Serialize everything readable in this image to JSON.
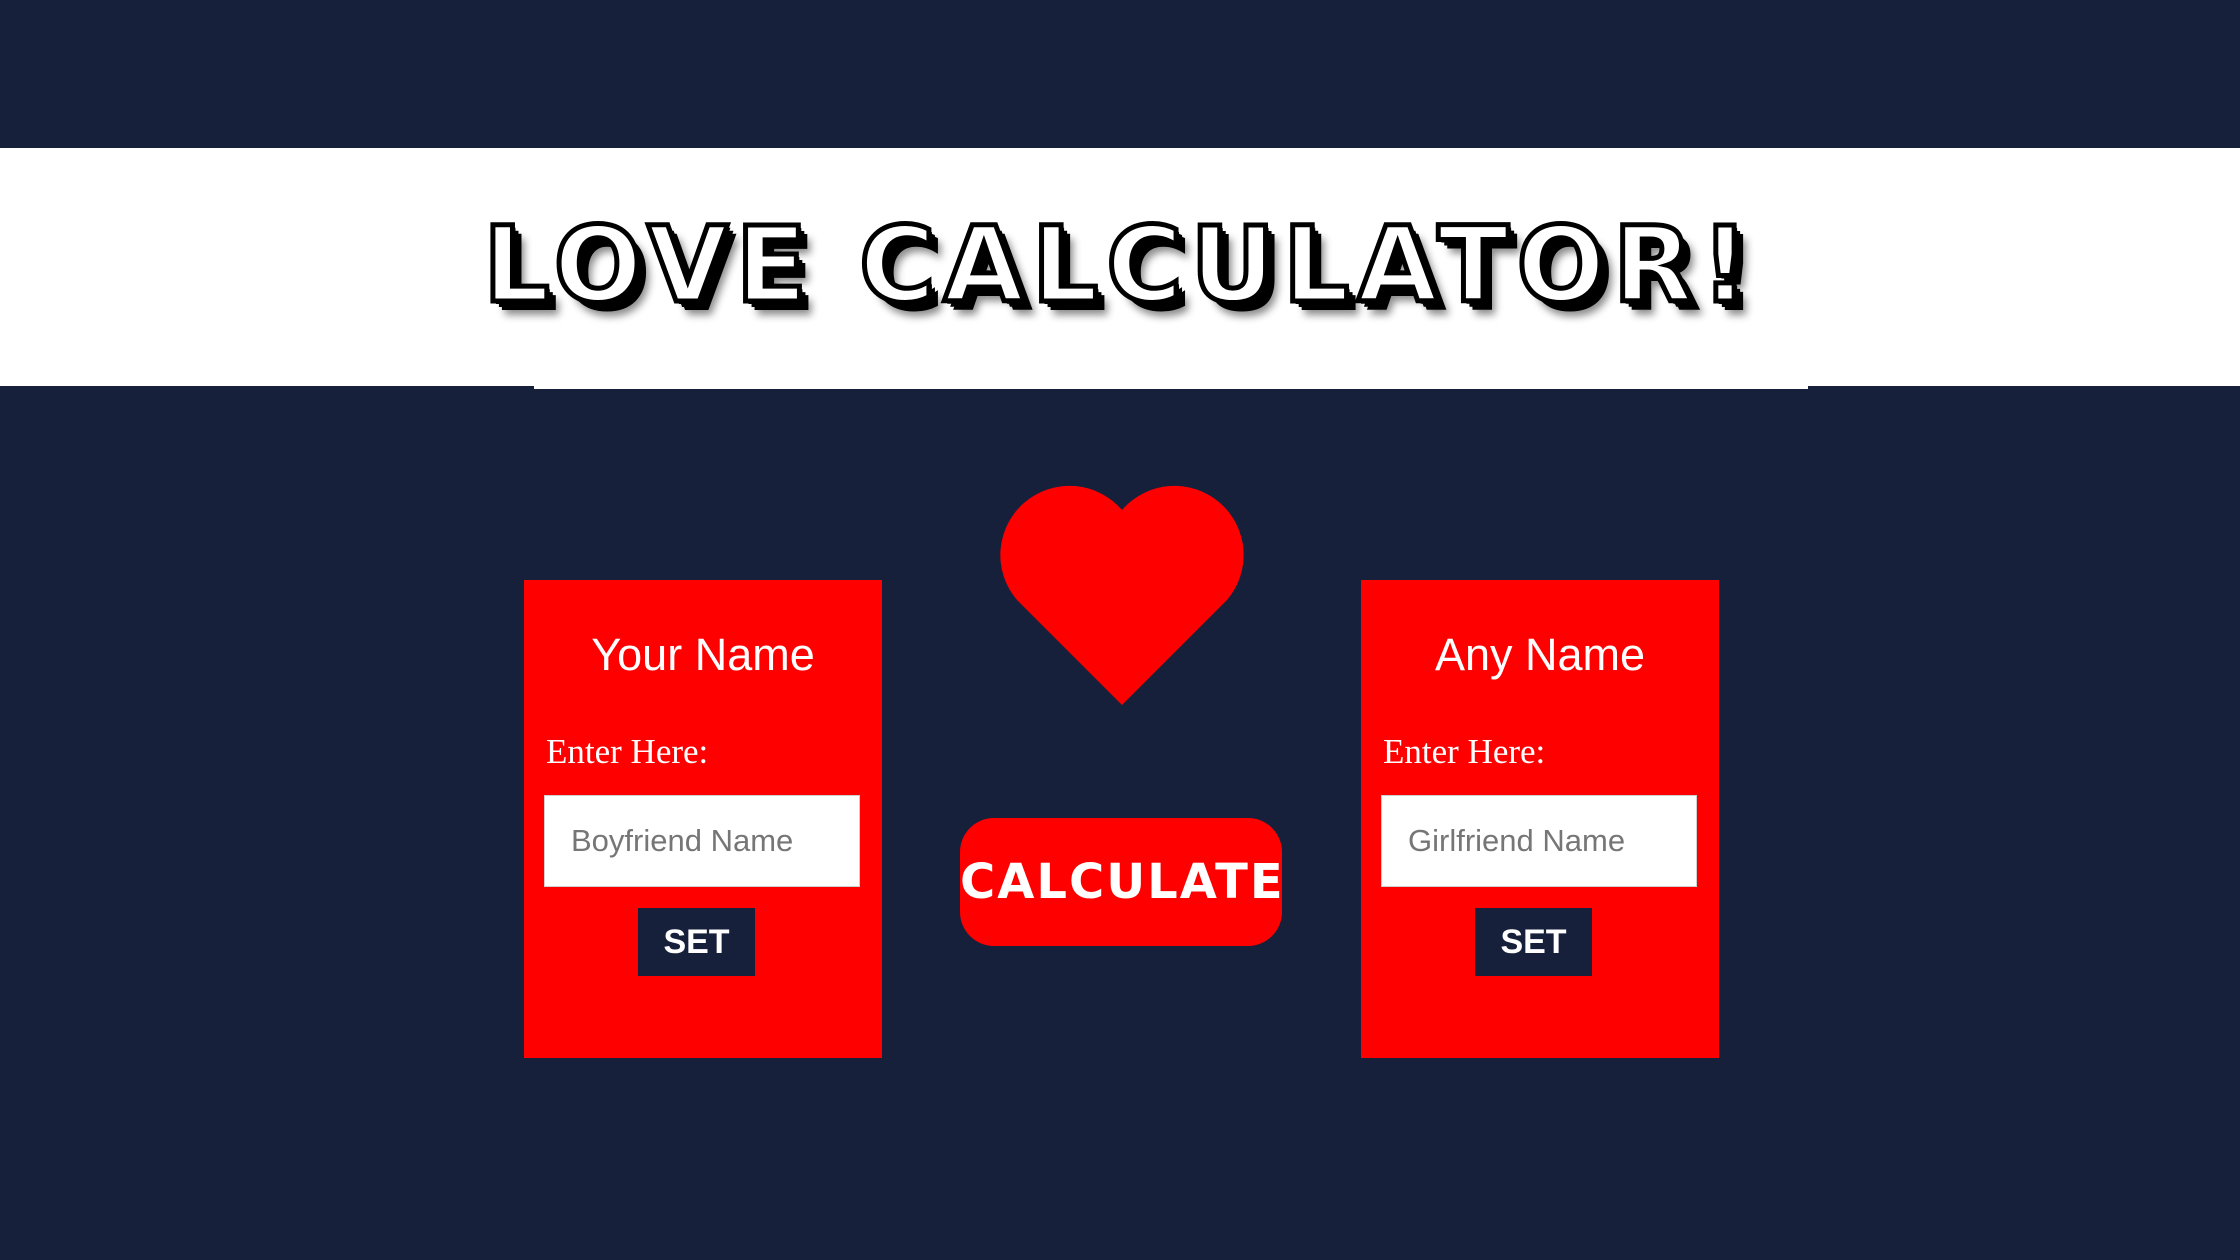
{
  "header": {
    "title": "LOVE CALCULATOR!"
  },
  "left_card": {
    "heading": "Your Name",
    "label": "Enter Here:",
    "placeholder": "Boyfriend Name",
    "value": "",
    "button_label": "SET"
  },
  "right_card": {
    "heading": "Any Name",
    "label": "Enter Here:",
    "placeholder": "Girlfriend Name",
    "value": "",
    "button_label": "SET"
  },
  "center": {
    "icon": "heart-icon",
    "calculate_label": "CALCULATE"
  },
  "colors": {
    "background": "#16203b",
    "banner": "#ffffff",
    "accent_red": "#ff0000",
    "set_button": "#16203b",
    "text_on_red": "#ffffff"
  }
}
